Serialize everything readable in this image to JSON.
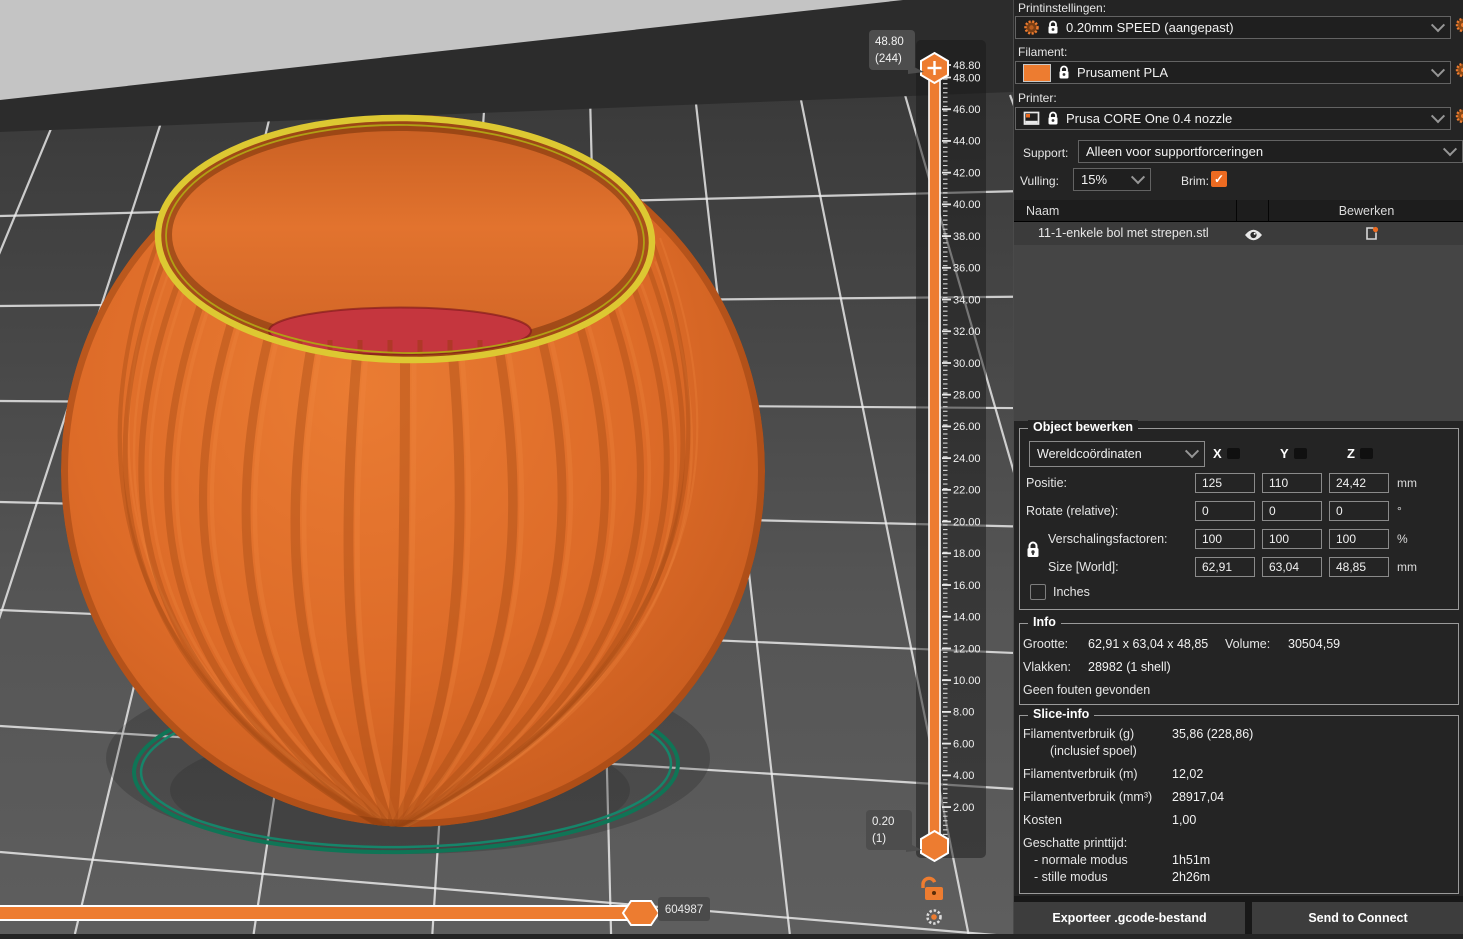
{
  "viewport": {
    "layer_slider": {
      "tooltip_top_line1": "48.80",
      "tooltip_top_line2": "(244)",
      "tooltip_bottom_line1": "0.20",
      "tooltip_bottom_line2": "(1)",
      "ruler_labels": [
        "48.80",
        "48.00",
        "46.00",
        "44.00",
        "42.00",
        "40.00",
        "38.00",
        "36.00",
        "34.00",
        "32.00",
        "30.00",
        "28.00",
        "26.00",
        "24.00",
        "22.00",
        "20.00",
        "18.00",
        "16.00",
        "14.00",
        "12.00",
        "10.00",
        "8.00",
        "6.00",
        "4.00",
        "2.00"
      ]
    },
    "move_slider": {
      "tooltip": "604987"
    },
    "colors": {
      "accent": "#ED6B21",
      "model_orange": "#DD6B28",
      "rim_yellow": "#DDC832",
      "floor_red": "#C5363E",
      "brim_teal": "#0F7556"
    }
  },
  "panel": {
    "print_settings": {
      "label": "Printinstellingen:",
      "value": "0.20mm SPEED (aangepast)"
    },
    "filament": {
      "label": "Filament:",
      "value": "Prusament PLA"
    },
    "printer": {
      "label": "Printer:",
      "value": "Prusa CORE One 0.4 nozzle"
    },
    "support": {
      "label": "Support:",
      "value": "Alleen voor supportforceringen"
    },
    "infill": {
      "label": "Vulling:",
      "value": "15%"
    },
    "brim": {
      "label": "Brim:",
      "checked": true,
      "check_glyph": "✓"
    },
    "object_table": {
      "col_name": "Naam",
      "col_edit": "Bewerken",
      "rows": [
        {
          "name": "11-1-enkele bol met strepen.stl"
        }
      ]
    },
    "object_manipulation": {
      "title": "Object bewerken",
      "coord_system": "Wereldcoördinaten",
      "axes": [
        "X",
        "Y",
        "Z"
      ],
      "rows": [
        {
          "label": "Positie:",
          "values": [
            "125",
            "110",
            "24,42"
          ],
          "unit": "mm"
        },
        {
          "label": "Rotate (relative):",
          "values": [
            "0",
            "0",
            "0"
          ],
          "unit": "°"
        },
        {
          "label": "Verschalingsfactoren:",
          "values": [
            "100",
            "100",
            "100"
          ],
          "unit": "%"
        },
        {
          "label": "Size [World]:",
          "values": [
            "62,91",
            "63,04",
            "48,85"
          ],
          "unit": "mm"
        }
      ],
      "inches_label": "Inches"
    },
    "info": {
      "title": "Info",
      "size_label": "Grootte:",
      "size_value": "62,91 x 63,04 x 48,85",
      "volume_label": "Volume:",
      "volume_value": "30504,59",
      "facets_label": "Vlakken:",
      "facets_value": "28982 (1 shell)",
      "status": "Geen fouten gevonden"
    },
    "slice_info": {
      "title": "Slice-info",
      "rows": [
        {
          "label": "Filamentverbruik (g)",
          "value": "35,86 (228,86)"
        },
        {
          "label": "(inclusief spoel)",
          "value": ""
        },
        {
          "label": "Filamentverbruik (m)",
          "value": "12,02"
        },
        {
          "label": "Filamentverbruik (mm³)",
          "value": "28917,04"
        },
        {
          "label": "Kosten",
          "value": "1,00"
        },
        {
          "label": "Geschatte printtijd:",
          "value": ""
        },
        {
          "label": "- normale modus",
          "value": "1h51m"
        },
        {
          "label": "- stille modus",
          "value": "2h26m"
        }
      ]
    },
    "buttons": {
      "export": "Exporteer .gcode-bestand",
      "send": "Send to Connect"
    }
  }
}
